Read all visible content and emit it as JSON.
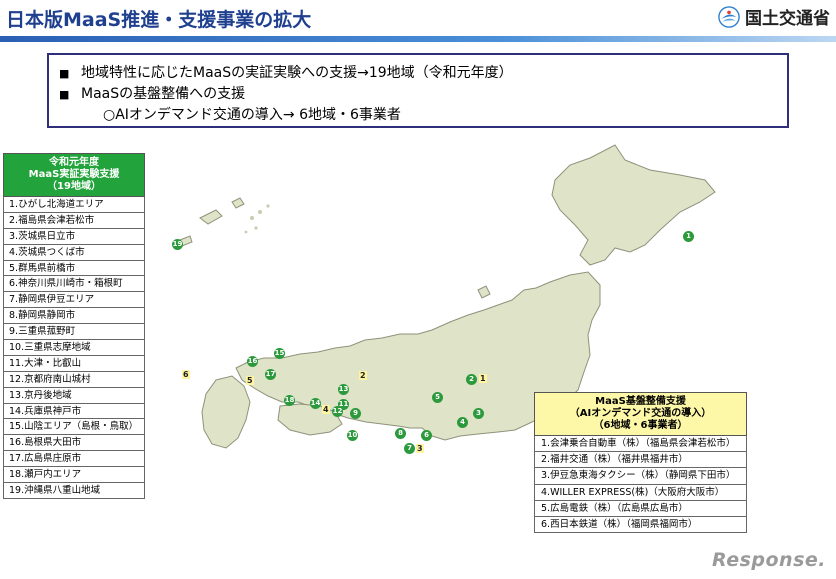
{
  "header": {
    "title": "日本版MaaS推進・支援事業の拡大",
    "ministry": "国土交通省"
  },
  "summary": {
    "lines": [
      "地域特性に応じたMaaSの実証実験への支援→19地域（令和元年度）",
      "MaaSの基盤整備への支援"
    ],
    "sub": "○AIオンデマンド交通の導入→ 6地域・6事業者"
  },
  "regions": {
    "header": [
      "令和元年度",
      "MaaS実証実験支援",
      "（19地域）"
    ],
    "items": [
      "1.ひがし北海道エリア",
      "2.福島県会津若松市",
      "3.茨城県日立市",
      "4.茨城県つくば市",
      "5.群馬県前橋市",
      "6.神奈川県川崎市・箱根町",
      "7.静岡県伊豆エリア",
      "8.静岡県静岡市",
      "9.三重県菰野町",
      "10.三重県志摩地域",
      "11.大津・比叡山",
      "12.京都府南山城村",
      "13.京丹後地域",
      "14.兵庫県神戸市",
      "15.山陰エリア（島根・鳥取）",
      "16.島根県大田市",
      "17.広島県庄原市",
      "18.瀬戸内エリア",
      "19.沖縄県八重山地域"
    ]
  },
  "infra": {
    "header": [
      "MaaS基盤整備支援",
      "（AIオンデマンド交通の導入）",
      "（6地域・6事業者）"
    ],
    "items": [
      "1.会津乗合自動車（株）（福島県会津若松市）",
      "2.福井交通（株）（福井県福井市）",
      "3.伊豆急東海タクシー（株）（静岡県下田市）",
      "4.WILLER EXPRESS(株)（大阪府大阪市）",
      "5.広島電鉄（株）（広島県広島市）",
      "6.西日本鉄道（株）（福岡県福岡市）"
    ]
  },
  "map": {
    "land_color": "#dfe3c8",
    "marker_color": "#2c9a3c",
    "label_color": "#fff5a0",
    "green_markers": [
      "1",
      "2",
      "3",
      "4",
      "5",
      "6",
      "7",
      "8",
      "9",
      "10",
      "11",
      "12",
      "13",
      "14",
      "15",
      "16",
      "17",
      "18",
      "19"
    ],
    "yellow_labels": [
      "1",
      "2",
      "3",
      "4",
      "5",
      "6"
    ]
  },
  "watermark": "Response."
}
